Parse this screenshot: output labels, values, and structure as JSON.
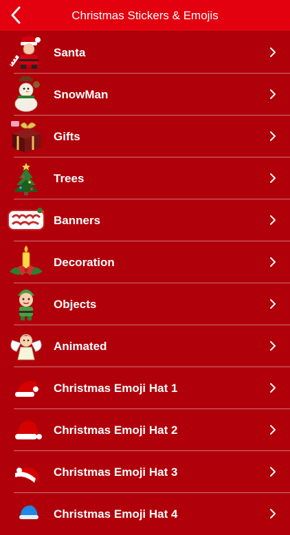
{
  "header": {
    "title": "Christmas Stickers & Emojis",
    "back_icon": "chevron-left-icon"
  },
  "colors": {
    "navbar": "#e3000f",
    "background": "#b0000a",
    "text": "#ffffff"
  },
  "items": [
    {
      "label": "Santa",
      "icon": "santa-icon"
    },
    {
      "label": "SnowMan",
      "icon": "snowman-icon"
    },
    {
      "label": "Gifts",
      "icon": "gift-icon"
    },
    {
      "label": "Trees",
      "icon": "christmas-tree-icon"
    },
    {
      "label": "Banners",
      "icon": "merry-christmas-banner-icon"
    },
    {
      "label": "Decoration",
      "icon": "candle-decoration-icon"
    },
    {
      "label": "Objects",
      "icon": "elf-icon"
    },
    {
      "label": "Animated",
      "icon": "angel-icon"
    },
    {
      "label": "Christmas Emoji Hat 1",
      "icon": "santa-hat-icon"
    },
    {
      "label": "Christmas Emoji Hat 2",
      "icon": "santa-hat-icon"
    },
    {
      "label": "Christmas Emoji Hat 3",
      "icon": "santa-hat-icon"
    },
    {
      "label": "Christmas Emoji Hat 4",
      "icon": "blue-hat-icon"
    }
  ]
}
